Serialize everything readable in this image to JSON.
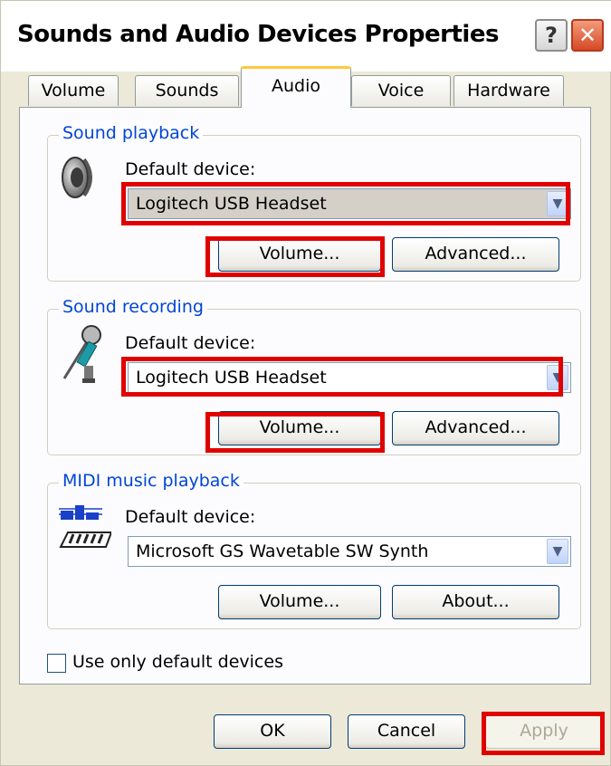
{
  "window": {
    "title": "Sounds and Audio Devices Properties",
    "help_glyph": "?",
    "close_glyph": "✕"
  },
  "tabs": [
    {
      "label": "Volume"
    },
    {
      "label": "Sounds"
    },
    {
      "label": "Audio"
    },
    {
      "label": "Voice"
    },
    {
      "label": "Hardware"
    }
  ],
  "playback": {
    "legend": "Sound playback",
    "default_label": "Default device:",
    "device": "Logitech USB Headset",
    "volume_label": "Volume...",
    "advanced_label": "Advanced..."
  },
  "recording": {
    "legend": "Sound recording",
    "default_label": "Default device:",
    "device": "Logitech USB Headset",
    "volume_label": "Volume...",
    "advanced_label": "Advanced..."
  },
  "midi": {
    "legend": "MIDI music playback",
    "default_label": "Default device:",
    "device": "Microsoft GS Wavetable SW Synth",
    "volume_label": "Volume...",
    "about_label": "About..."
  },
  "use_default_only": {
    "label": "Use only default devices",
    "checked": false
  },
  "footer": {
    "ok_label": "OK",
    "cancel_label": "Cancel",
    "apply_label": "Apply"
  },
  "colors": {
    "highlight": "#e00000",
    "legend": "#0046d5",
    "tab_accent": "#ffc83c"
  }
}
